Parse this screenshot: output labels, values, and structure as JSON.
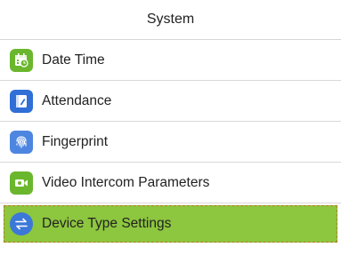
{
  "header": {
    "title": "System"
  },
  "menu": {
    "items": [
      {
        "label": "Date Time",
        "icon": "calendar-clock-icon",
        "color": "#6ab72d",
        "selected": false
      },
      {
        "label": "Attendance",
        "icon": "attendance-book-icon",
        "color": "#2f6fd6",
        "selected": false
      },
      {
        "label": "Fingerprint",
        "icon": "fingerprint-icon",
        "color": "#4d86e0",
        "selected": false
      },
      {
        "label": "Video Intercom Parameters",
        "icon": "video-camera-icon",
        "color": "#6ab72d",
        "selected": false
      },
      {
        "label": "Device Type Settings",
        "icon": "swap-arrows-icon",
        "color": "#3c78d8",
        "selected": true
      }
    ]
  },
  "colors": {
    "selected_bg": "#8dc63f",
    "divider": "#d9d9d9"
  }
}
